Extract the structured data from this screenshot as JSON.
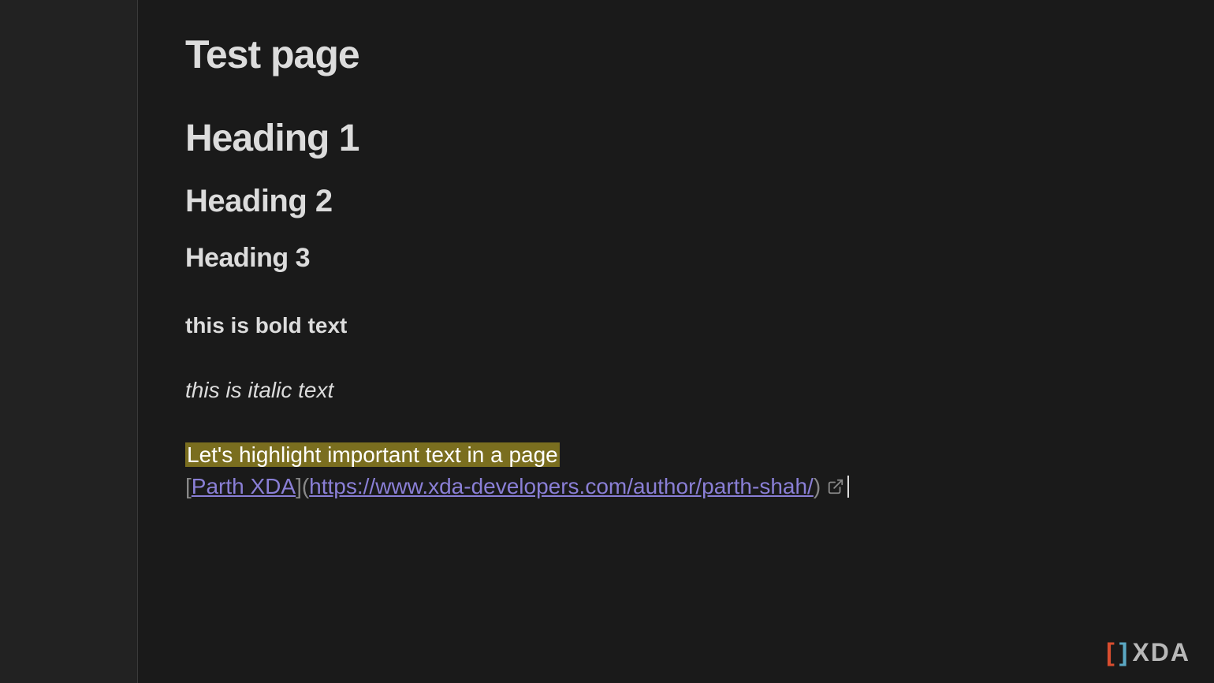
{
  "page": {
    "title": "Test page",
    "heading1": "Heading 1",
    "heading2": "Heading 2",
    "heading3": "Heading 3",
    "bold_text": "this is bold text",
    "italic_text": "this is italic text",
    "highlight_text": "Let's highlight important text in a page",
    "link": {
      "bracket_open": "[",
      "label": "Parth XDA",
      "bracket_close": "]",
      "paren_open": "(",
      "url": "https://www.xda-developers.com/author/parth-shah/",
      "paren_close": ")"
    }
  },
  "watermark": {
    "bracket_left": "[",
    "bracket_right": "]",
    "text": "XDA"
  }
}
